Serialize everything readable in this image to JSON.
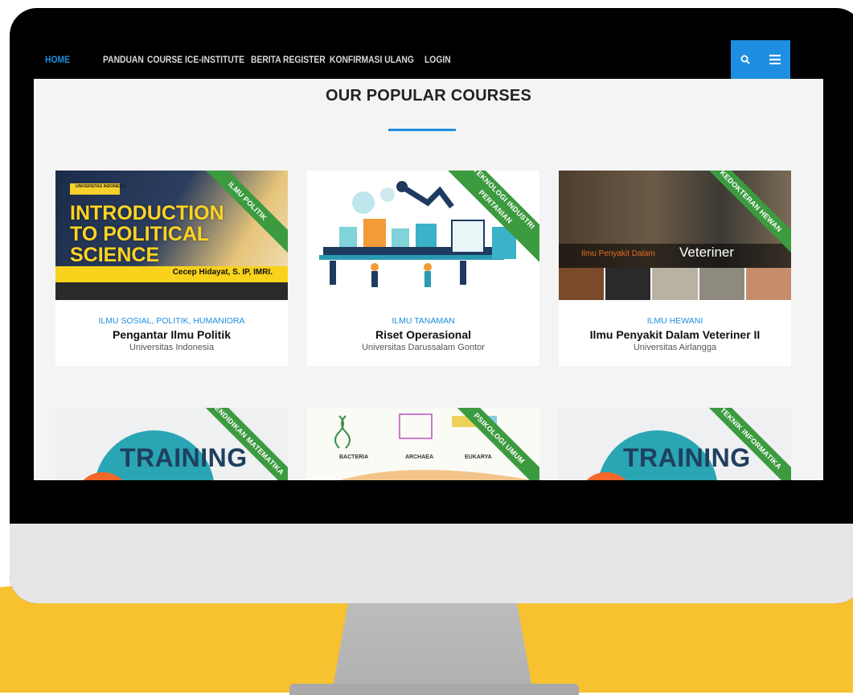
{
  "colors": {
    "accent": "#1e8ee0",
    "ribbon": "#3c9a3f",
    "mockup_yellow": "#f7c12f"
  },
  "nav": {
    "items": [
      "HOME",
      "PANDUAN",
      "COURSE",
      "ICE-INSTITUTE",
      "BERITA",
      "REGISTER",
      "KONFIRMASI ULANG",
      "LOGIN"
    ],
    "active": "HOME",
    "search_icon": "search-icon",
    "menu_icon": "hamburger-menu-icon"
  },
  "section": {
    "title": "OUR POPULAR COURSES"
  },
  "courses": [
    {
      "ribbon": "ILMU POLITIK",
      "category": "ILMU SOSIAL, POLITIK, HUMANIORA",
      "title": "Pengantar Ilmu Politik",
      "institution": "Universitas Indonesia",
      "image": {
        "logo": "UNIVERSITAS INDONESIA",
        "line1": "INTRODUCTION",
        "line2": "TO POLITICAL",
        "line3": "SCIENCE",
        "lecturer": "Cecep Hidayat, S. IP, IMRI."
      }
    },
    {
      "ribbon_line1": "TEKNOLOGI INDUSTRI",
      "ribbon_line2": "PERTANIAN",
      "category": "ILMU TANAMAN",
      "title": "Riset Operasional",
      "institution": "Universitas Darussalam Gontor"
    },
    {
      "ribbon": "KEDOKTERAN HEWAN",
      "category": "ILMU HEWANI",
      "title": "Ilmu Penyakit Dalam Veteriner II",
      "institution": "Universitas Airlangga",
      "image": {
        "text1": "Ilmu Penyakit Dalam",
        "text2": "Veteriner"
      }
    },
    {
      "ribbon": "PENDIDIKAN MATEMATIKA",
      "image": {
        "text": "TRAINING"
      }
    },
    {
      "ribbon": "PSIKOLOGI UMUM",
      "image": {
        "col1": "BACTERIA",
        "col2": "ARCHAEA",
        "col3": "EUKARYA"
      }
    },
    {
      "ribbon": "TEKNIK INFORMATIKA",
      "image": {
        "text": "TRAINING"
      }
    }
  ]
}
